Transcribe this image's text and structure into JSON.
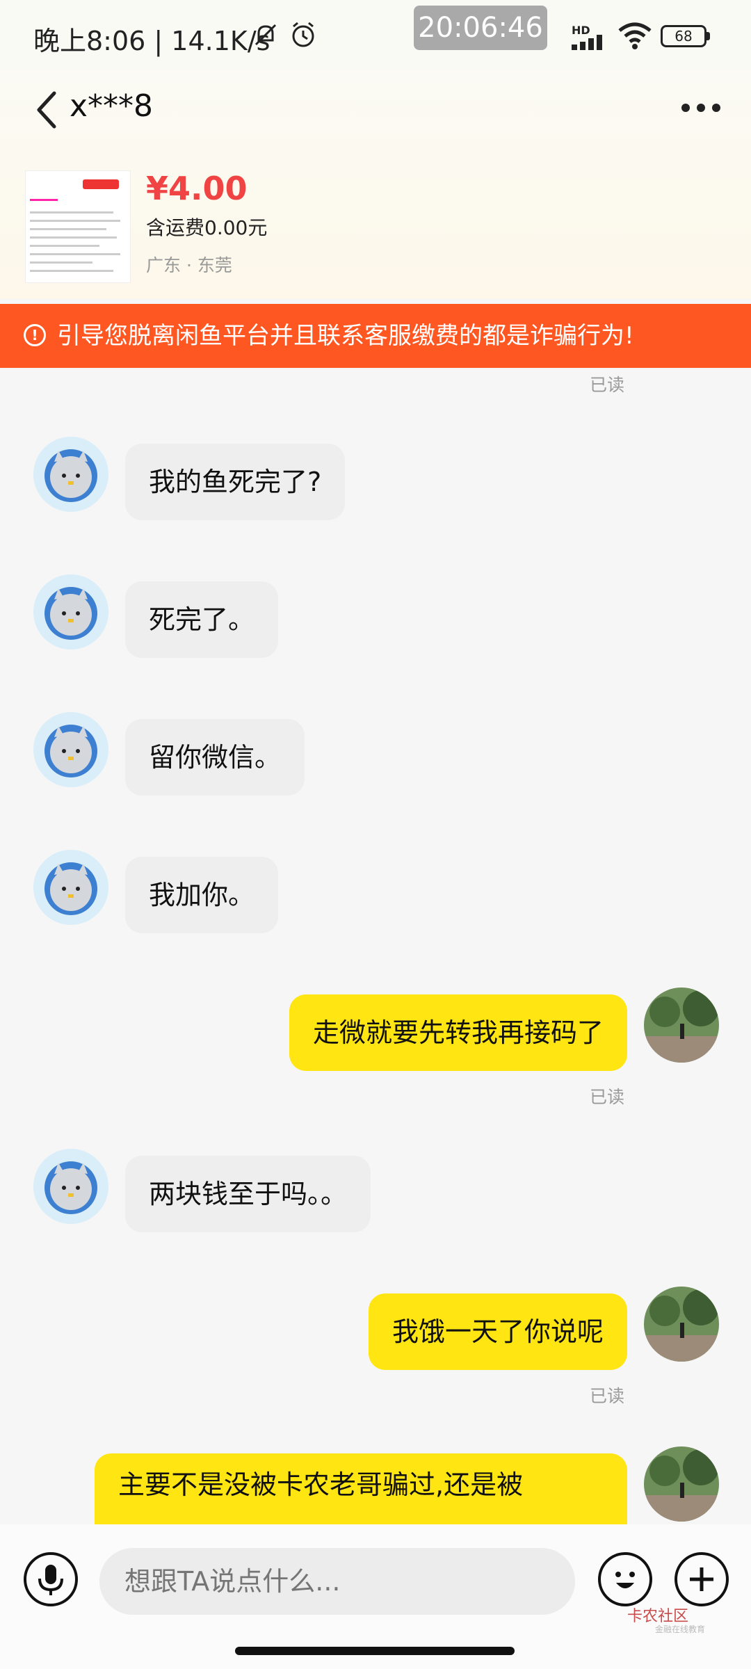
{
  "status_bar": {
    "left_text": "晚上8:06 | 14.1K/s",
    "center_time": "20:06:46",
    "network_label": "HD",
    "battery": "68"
  },
  "header": {
    "title": "x***8"
  },
  "product": {
    "price": "¥4.00",
    "freight": "含运费0.00元",
    "location": "广东 · 东莞"
  },
  "warning": {
    "icon": "!",
    "text": "引导您脱离闲鱼平台并且联系客服缴费的都是诈骗行为!"
  },
  "chat": {
    "read_label": "已读",
    "messages": [
      {
        "side": "left",
        "text": "我的鱼死完了?"
      },
      {
        "side": "left",
        "text": "死完了。"
      },
      {
        "side": "left",
        "text": "留你微信。"
      },
      {
        "side": "left",
        "text": "我加你。"
      },
      {
        "side": "right",
        "text": "走微就要先转我再接码了"
      },
      {
        "side": "left",
        "text": "两块钱至于吗。。"
      },
      {
        "side": "right",
        "text": "我饿一天了你说呢"
      },
      {
        "side": "right",
        "text": "主要不是没被卡农老哥骗过,还是被"
      }
    ]
  },
  "input_bar": {
    "placeholder": "想跟TA说点什么..."
  },
  "watermark": {
    "title": "卡农社区",
    "subtitle": "金融在线教育"
  },
  "colors": {
    "price": "#f04444",
    "warning_bg": "#ff5722",
    "my_bubble": "#ffe512",
    "other_bubble": "#eeeeee"
  }
}
